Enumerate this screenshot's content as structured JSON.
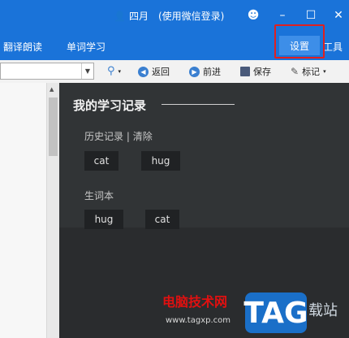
{
  "titlebar": {
    "user_name": "四月",
    "login_note": "(使用微信登录)",
    "controls": {
      "emoji": "☻",
      "minimize": "–",
      "maximize": "☐",
      "close": "✕"
    }
  },
  "menubar": {
    "items": [
      "翻译朗读",
      "单词学习"
    ],
    "settings": "设置",
    "tools": "工具"
  },
  "toolbar": {
    "back": "返回",
    "forward": "前进",
    "save": "保存",
    "mark": "标记"
  },
  "content": {
    "heading": "我的学习记录",
    "history_label": "历史记录",
    "separator": "|",
    "clear": "清除",
    "history_words": [
      "cat",
      "hug"
    ],
    "wordbook_label": "生词本",
    "wordbook_words": [
      "hug",
      "cat"
    ]
  },
  "watermark": {
    "text": "电脑技术网",
    "url": "www.tagxp.com",
    "logo": "TAG",
    "right": "载站"
  },
  "colors": {
    "accent": "#1a73d9",
    "highlight": "#e02020",
    "dark_panel": "#313436"
  }
}
